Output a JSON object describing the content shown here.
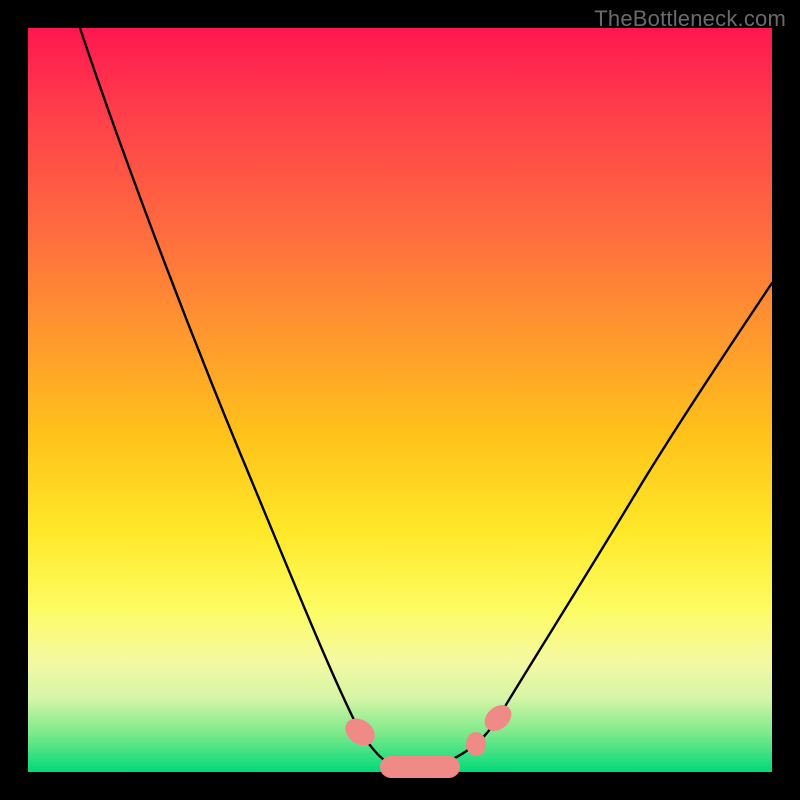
{
  "watermark": "TheBottleneck.com",
  "chart_data": {
    "type": "line",
    "title": "",
    "xlabel": "",
    "ylabel": "",
    "xlim": [
      0,
      100
    ],
    "ylim": [
      0,
      100
    ],
    "series": [
      {
        "name": "bottleneck-curve",
        "x": [
          7,
          12,
          18,
          24,
          30,
          36,
          40,
          44,
          47,
          50,
          53,
          56,
          60,
          63,
          67,
          74,
          82,
          90,
          100
        ],
        "y": [
          100,
          88,
          73,
          58,
          44,
          30,
          20,
          12,
          6,
          3,
          2,
          2,
          3,
          5,
          10,
          20,
          33,
          47,
          62
        ]
      }
    ],
    "markers": [
      {
        "name": "valley-left",
        "cx": 44,
        "cy": 6
      },
      {
        "name": "valley-mid-l",
        "cx": 50,
        "cy": 2
      },
      {
        "name": "valley-mid-r",
        "cx": 57,
        "cy": 2
      },
      {
        "name": "valley-right",
        "cx": 63,
        "cy": 6
      }
    ],
    "background_gradient": {
      "top": "#ff1750",
      "mid": "#ffe92a",
      "bottom": "#00d97a"
    }
  }
}
